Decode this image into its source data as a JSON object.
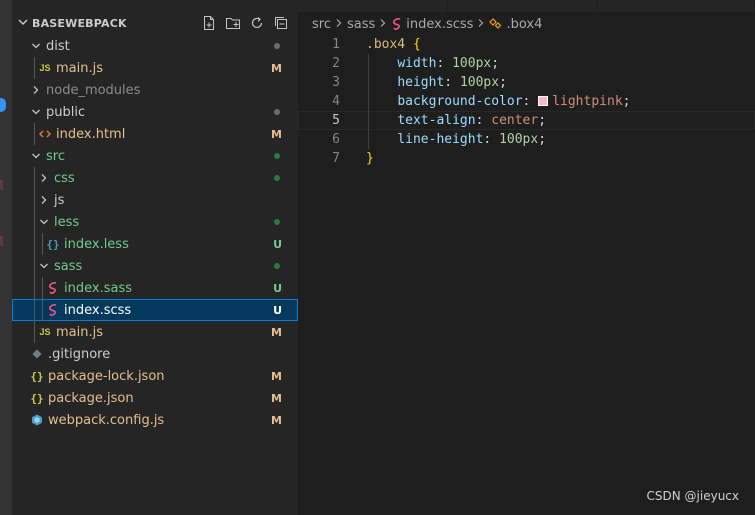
{
  "explorer": {
    "title": "BASEWEBPACK",
    "actions": [
      {
        "icon": "new-file-icon"
      },
      {
        "icon": "new-folder-icon"
      },
      {
        "icon": "refresh-icon"
      },
      {
        "icon": "collapse-all-icon"
      }
    ],
    "items": [
      {
        "name": "dist",
        "kind": "folder",
        "expanded": true,
        "depth": 0,
        "status_dot": "#8c8c8c",
        "label_color": "def"
      },
      {
        "name": "main.js",
        "kind": "js",
        "depth": 1,
        "status": "M",
        "label_color": "mod"
      },
      {
        "name": "node_modules",
        "kind": "folder",
        "expanded": false,
        "depth": 0,
        "label_color": "dim"
      },
      {
        "name": "public",
        "kind": "folder",
        "expanded": true,
        "depth": 0,
        "status_dot": "#8c8c8c",
        "label_color": "def"
      },
      {
        "name": "index.html",
        "kind": "html",
        "depth": 1,
        "status": "M",
        "label_color": "mod"
      },
      {
        "name": "src",
        "kind": "folder",
        "expanded": true,
        "depth": 0,
        "status_dot": "#2ea043",
        "label_color": "unt"
      },
      {
        "name": "css",
        "kind": "folder",
        "expanded": false,
        "depth": 1,
        "status_dot": "#2ea043",
        "label_color": "unt"
      },
      {
        "name": "js",
        "kind": "folder",
        "expanded": false,
        "depth": 1,
        "label_color": "def"
      },
      {
        "name": "less",
        "kind": "folder",
        "expanded": true,
        "depth": 1,
        "status_dot": "#2ea043",
        "label_color": "unt"
      },
      {
        "name": "index.less",
        "kind": "less",
        "depth": 2,
        "status": "U",
        "label_color": "unt"
      },
      {
        "name": "sass",
        "kind": "folder",
        "expanded": true,
        "depth": 1,
        "status_dot": "#2ea043",
        "label_color": "unt"
      },
      {
        "name": "index.sass",
        "kind": "sass",
        "depth": 2,
        "status": "U",
        "label_color": "unt"
      },
      {
        "name": "index.scss",
        "kind": "sass",
        "depth": 2,
        "status": "U",
        "label_color": "sel",
        "selected": true
      },
      {
        "name": "main.js",
        "kind": "js",
        "depth": 1,
        "status": "M",
        "label_color": "mod"
      },
      {
        "name": ".gitignore",
        "kind": "gitignore",
        "depth": 0,
        "label_color": "def"
      },
      {
        "name": "package-lock.json",
        "kind": "json",
        "depth": 0,
        "status": "M",
        "label_color": "mod"
      },
      {
        "name": "package.json",
        "kind": "json",
        "depth": 0,
        "status": "M",
        "label_color": "mod"
      },
      {
        "name": "webpack.config.js",
        "kind": "webpack",
        "depth": 0,
        "status": "M",
        "label_color": "mod"
      }
    ]
  },
  "breadcrumb": {
    "parts": [
      "src",
      "sass"
    ],
    "file": "index.scss",
    "symbol": ".box4"
  },
  "editor": {
    "active_line": 5,
    "lines": [
      {
        "n": "1",
        "tokens": [
          {
            "t": ".box4",
            "c": "sel"
          },
          {
            "t": " ",
            "c": "punc"
          },
          {
            "t": "{",
            "c": "brace"
          }
        ]
      },
      {
        "n": "2",
        "tokens": [
          {
            "t": "    ",
            "c": "punc"
          },
          {
            "t": "width",
            "c": "prop"
          },
          {
            "t": ": ",
            "c": "punc"
          },
          {
            "t": "100px",
            "c": "num"
          },
          {
            "t": ";",
            "c": "punc"
          }
        ]
      },
      {
        "n": "3",
        "tokens": [
          {
            "t": "    ",
            "c": "punc"
          },
          {
            "t": "height",
            "c": "prop"
          },
          {
            "t": ": ",
            "c": "punc"
          },
          {
            "t": "100px",
            "c": "num"
          },
          {
            "t": ";",
            "c": "punc"
          }
        ]
      },
      {
        "n": "4",
        "tokens": [
          {
            "t": "    ",
            "c": "punc"
          },
          {
            "t": "background-color",
            "c": "prop"
          },
          {
            "t": ": ",
            "c": "punc"
          },
          {
            "t": "",
            "c": "swatch",
            "color": "#ffb6c1"
          },
          {
            "t": "lightpink",
            "c": "val"
          },
          {
            "t": ";",
            "c": "punc"
          }
        ]
      },
      {
        "n": "5",
        "tokens": [
          {
            "t": "    ",
            "c": "punc"
          },
          {
            "t": "text-align",
            "c": "prop"
          },
          {
            "t": ": ",
            "c": "punc"
          },
          {
            "t": "center",
            "c": "val"
          },
          {
            "t": ";",
            "c": "punc"
          }
        ]
      },
      {
        "n": "6",
        "tokens": [
          {
            "t": "    ",
            "c": "punc"
          },
          {
            "t": "line-height",
            "c": "prop"
          },
          {
            "t": ": ",
            "c": "punc"
          },
          {
            "t": "100px",
            "c": "num"
          },
          {
            "t": ";",
            "c": "punc"
          }
        ]
      },
      {
        "n": "7",
        "tokens": [
          {
            "t": "}",
            "c": "brace"
          }
        ]
      }
    ]
  },
  "watermark": "CSDN @jieyucx"
}
